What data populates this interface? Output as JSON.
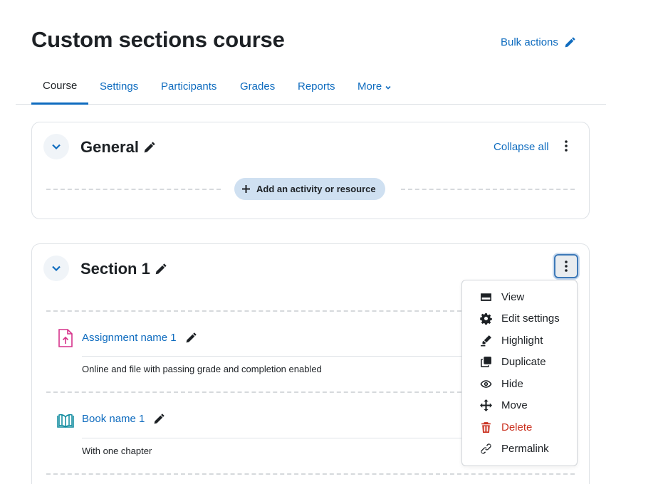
{
  "page": {
    "title": "Custom sections course",
    "bulk_actions": "Bulk actions"
  },
  "nav": {
    "tabs": [
      {
        "label": "Course",
        "active": true
      },
      {
        "label": "Settings"
      },
      {
        "label": "Participants"
      },
      {
        "label": "Grades"
      },
      {
        "label": "Reports"
      },
      {
        "label": "More"
      }
    ]
  },
  "general": {
    "title": "General",
    "collapse_all": "Collapse all",
    "add_activity": "Add an activity or resource"
  },
  "section1": {
    "title": "Section 1",
    "activities": [
      {
        "name": "Assignment name 1",
        "description": "Online and file with passing grade and completion enabled",
        "icon": "assignment-upload-icon",
        "color": "#d6338b"
      },
      {
        "name": "Book name 1",
        "description": "With one chapter",
        "icon": "book-icon",
        "color": "#0d8a9e"
      }
    ]
  },
  "section_menu": {
    "items": [
      {
        "label": "View",
        "icon": "view-icon"
      },
      {
        "label": "Edit settings",
        "icon": "gear-icon"
      },
      {
        "label": "Highlight",
        "icon": "highlighter-icon"
      },
      {
        "label": "Duplicate",
        "icon": "duplicate-icon"
      },
      {
        "label": "Hide",
        "icon": "eye-icon"
      },
      {
        "label": "Move",
        "icon": "move-arrows-icon"
      },
      {
        "label": "Delete",
        "icon": "trash-icon",
        "color": "#ca3120"
      },
      {
        "label": "Permalink",
        "icon": "link-icon"
      }
    ]
  },
  "colors": {
    "link": "#0f6cbf",
    "text": "#1d2125",
    "danger": "#ca3120",
    "add_button_bg": "#cfe0f1"
  }
}
